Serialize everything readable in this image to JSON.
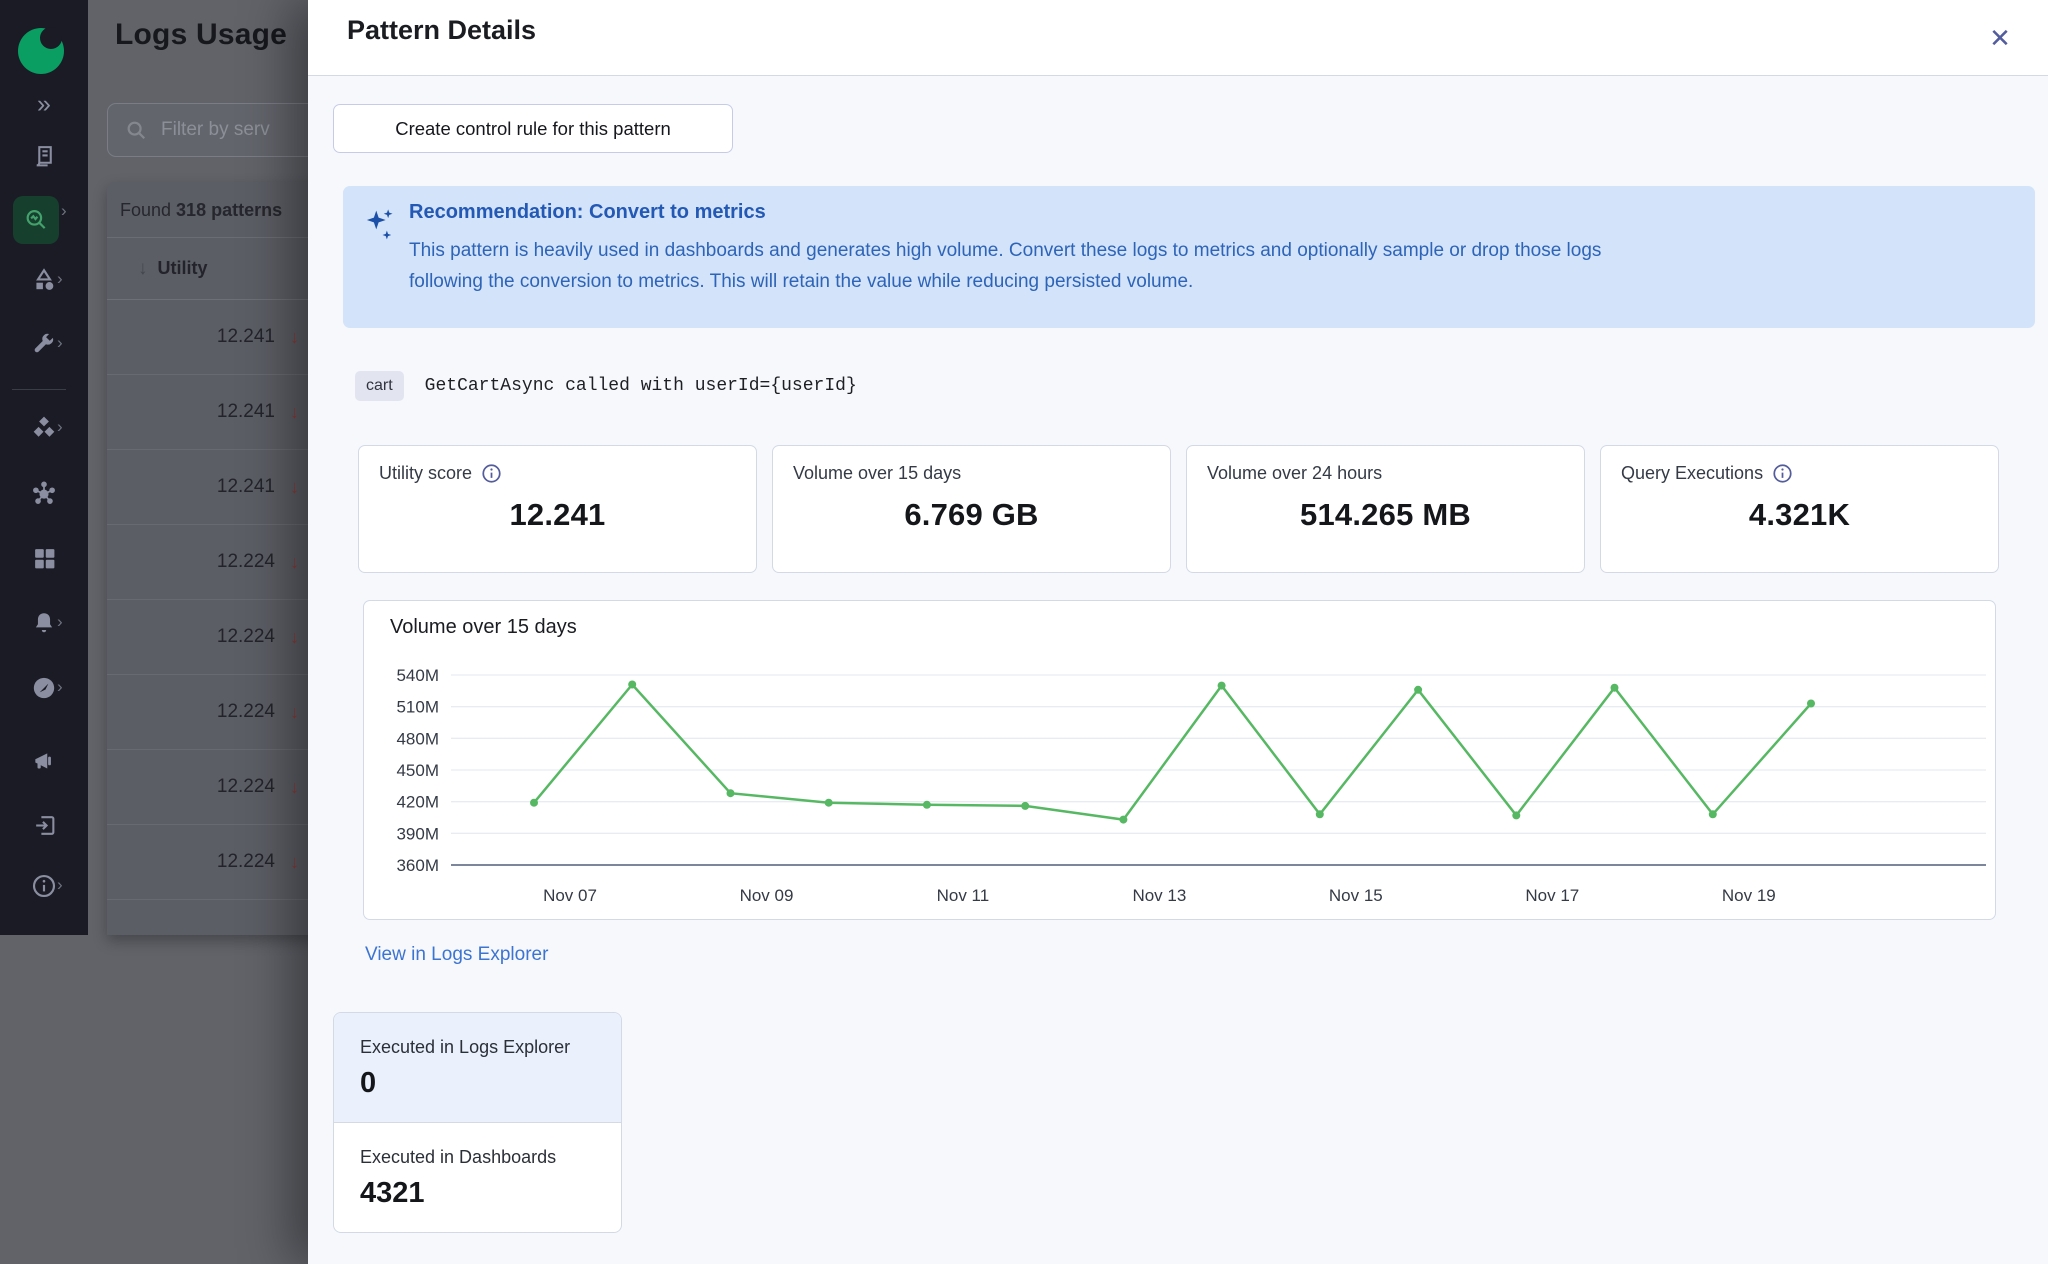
{
  "sidebar": {
    "icons": [
      "logo",
      "expand",
      "logs",
      "log-pattern-analysis",
      "visualizations",
      "dev-tools",
      "integrations",
      "graph",
      "dashboards",
      "alerts",
      "observability",
      "announcements",
      "exit",
      "info"
    ],
    "active_item": "log-pattern-analysis",
    "accent_green": "#0a9e63",
    "active_tile_bg": "#173f2e"
  },
  "background": {
    "page_title": "Logs Usage",
    "filter_placeholder": "Filter by serv",
    "found_prefix": "Found ",
    "found_bold": "318 patterns",
    "column_header": "Utility",
    "sort_icon": "arrow-down",
    "rows": [
      {
        "utility": "12.241",
        "trend": "down"
      },
      {
        "utility": "12.241",
        "trend": "down"
      },
      {
        "utility": "12.241",
        "trend": "down"
      },
      {
        "utility": "12.224",
        "trend": "down"
      },
      {
        "utility": "12.224",
        "trend": "down"
      },
      {
        "utility": "12.224",
        "trend": "down"
      },
      {
        "utility": "12.224",
        "trend": "down"
      },
      {
        "utility": "12.224",
        "trend": "down"
      }
    ],
    "trend_color": "#8f3a36"
  },
  "drawer": {
    "title": "Pattern Details",
    "close_icon": "✕",
    "create_rule_button": "Create control rule for this pattern",
    "recommendation": {
      "icon": "sparkles",
      "title": "Recommendation: Convert to metrics",
      "line1": "This pattern is heavily used in dashboards and generates high volume. Convert these logs to metrics and optionally sample or drop those logs",
      "line2": "following the conversion to metrics. This will retain the value while reducing persisted volume.",
      "bg": "#d3e3fa",
      "text_color": "#2e64b8"
    },
    "pattern": {
      "badge": "cart",
      "text": "GetCartAsync called with userId={userId}"
    },
    "stats": [
      {
        "label": "Utility score",
        "has_info_icon": true,
        "value": "12.241"
      },
      {
        "label": "Volume over 15 days",
        "has_info_icon": false,
        "value": "6.769 GB"
      },
      {
        "label": "Volume over 24 hours",
        "has_info_icon": false,
        "value": "514.265 MB"
      },
      {
        "label": "Query Executions",
        "has_info_icon": true,
        "value": "4.321K"
      }
    ],
    "view_link": "View in Logs Explorer",
    "link_color": "#3b74d1",
    "executions": [
      {
        "label": "Executed in Logs Explorer",
        "value": "0"
      },
      {
        "label": "Executed in Dashboards",
        "value": "4321"
      }
    ]
  },
  "chart_data": {
    "type": "line",
    "title": "Volume over 15 days",
    "x": [
      "Nov 07",
      "Nov 08",
      "Nov 09",
      "Nov 10",
      "Nov 11",
      "Nov 12",
      "Nov 13",
      "Nov 14",
      "Nov 15",
      "Nov 16",
      "Nov 17",
      "Nov 18",
      "Nov 19",
      "Nov 20"
    ],
    "values_millions": [
      419,
      531,
      428,
      419,
      417,
      416,
      403,
      530,
      408,
      526,
      407,
      528,
      408,
      513
    ],
    "ylabel_unit": "M",
    "y_ticks": [
      "540M",
      "510M",
      "480M",
      "450M",
      "420M",
      "390M",
      "360M"
    ],
    "y_tick_values": [
      540,
      510,
      480,
      450,
      420,
      390,
      360
    ],
    "x_tick_labels": [
      "Nov 07",
      "Nov 09",
      "Nov 11",
      "Nov 13",
      "Nov 15",
      "Nov 17",
      "Nov 19"
    ],
    "ylim": [
      360,
      540
    ],
    "grid": true,
    "legend": false,
    "line_color": "#57b863",
    "baseline_color": "#7d879c"
  }
}
